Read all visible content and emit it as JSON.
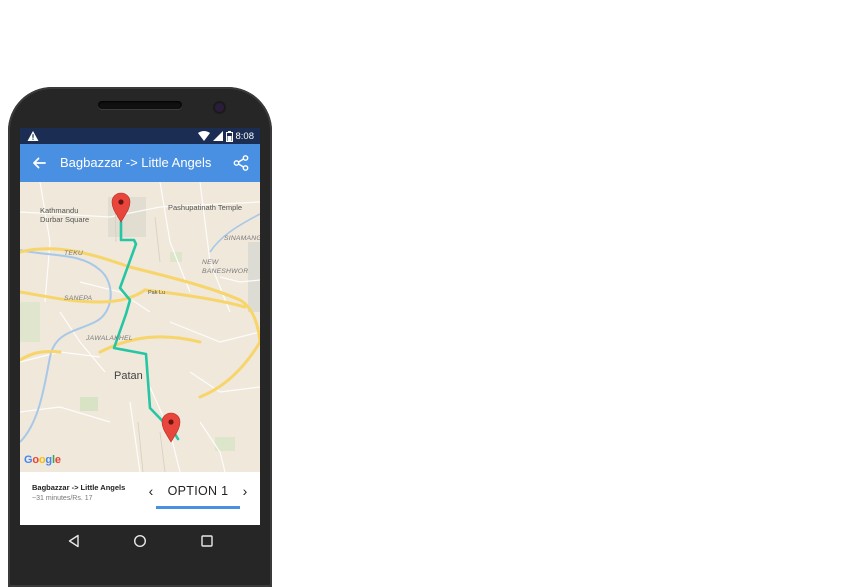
{
  "status_bar": {
    "time": "8:08",
    "icons": [
      "warning-icon",
      "wifi-icon",
      "signal-icon",
      "battery-icon"
    ]
  },
  "app_bar": {
    "title": "Bagbazzar -> Little Angels",
    "back_icon": "arrow-left-icon",
    "share_icon": "share-icon",
    "color": "#4a90e2"
  },
  "map": {
    "labels": {
      "kathmandu": "Kathmandu\nDurbar Square",
      "pashupatinath": "Pashupatinath Temple",
      "sinamangal": "SINAMANGA",
      "teku": "TEKU",
      "new_baneshwor": "NEW\nBANESHWOR",
      "sanepa": "SANEPA",
      "jawalakhel": "JAWALAKHEL",
      "patan": "Patan",
      "paklu": "Pak Lu"
    },
    "attribution": "Google",
    "route_color": "#26c6a4",
    "marker_color": "#e8453c"
  },
  "bottom_panel": {
    "route_title": "Bagbazzar -> Little Angels",
    "route_meta": "~31 minutes/Rs. 17",
    "option_label": "OPTION 1",
    "prev_icon": "chevron-left-icon",
    "next_icon": "chevron-right-icon",
    "accent": "#4a90e2"
  },
  "nav_bar": {
    "icons": [
      "nav-back-icon",
      "nav-home-icon",
      "nav-recent-icon"
    ]
  }
}
